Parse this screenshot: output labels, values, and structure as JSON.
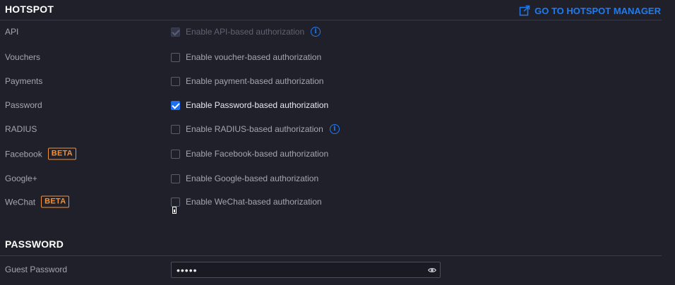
{
  "hotspot": {
    "title": "HOTSPOT",
    "manager_link": "GO TO HOTSPOT MANAGER",
    "rows": [
      {
        "label": "API",
        "option": "Enable API-based authorization",
        "state": "disabled-checked",
        "info": true,
        "beta": ""
      },
      {
        "label": "Vouchers",
        "option": "Enable voucher-based authorization",
        "state": "unchecked",
        "info": false,
        "beta": ""
      },
      {
        "label": "Payments",
        "option": "Enable payment-based authorization",
        "state": "unchecked",
        "info": false,
        "beta": ""
      },
      {
        "label": "Password",
        "option": "Enable Password-based authorization",
        "state": "checked",
        "info": false,
        "beta": ""
      },
      {
        "label": "RADIUS",
        "option": "Enable RADIUS-based authorization",
        "state": "unchecked",
        "info": true,
        "beta": ""
      },
      {
        "label": "Facebook",
        "option": "Enable Facebook-based authorization",
        "state": "unchecked",
        "info": false,
        "beta": "BETA"
      },
      {
        "label": "Google+",
        "option": "Enable Google-based authorization",
        "state": "unchecked",
        "info": false,
        "beta": ""
      },
      {
        "label": "WeChat",
        "option": "Enable WeChat-based authorization",
        "state": "unchecked",
        "info": false,
        "beta": "BETA"
      }
    ]
  },
  "password": {
    "title": "PASSWORD",
    "guest_label": "Guest Password",
    "guest_value": "•••••"
  },
  "colors": {
    "background": "#1f2029",
    "accent": "#1d7cf2",
    "beta": "#f0923a"
  },
  "icons": {
    "manager_link": "external-link-icon",
    "info": "info-icon",
    "reveal": "eye-icon"
  }
}
